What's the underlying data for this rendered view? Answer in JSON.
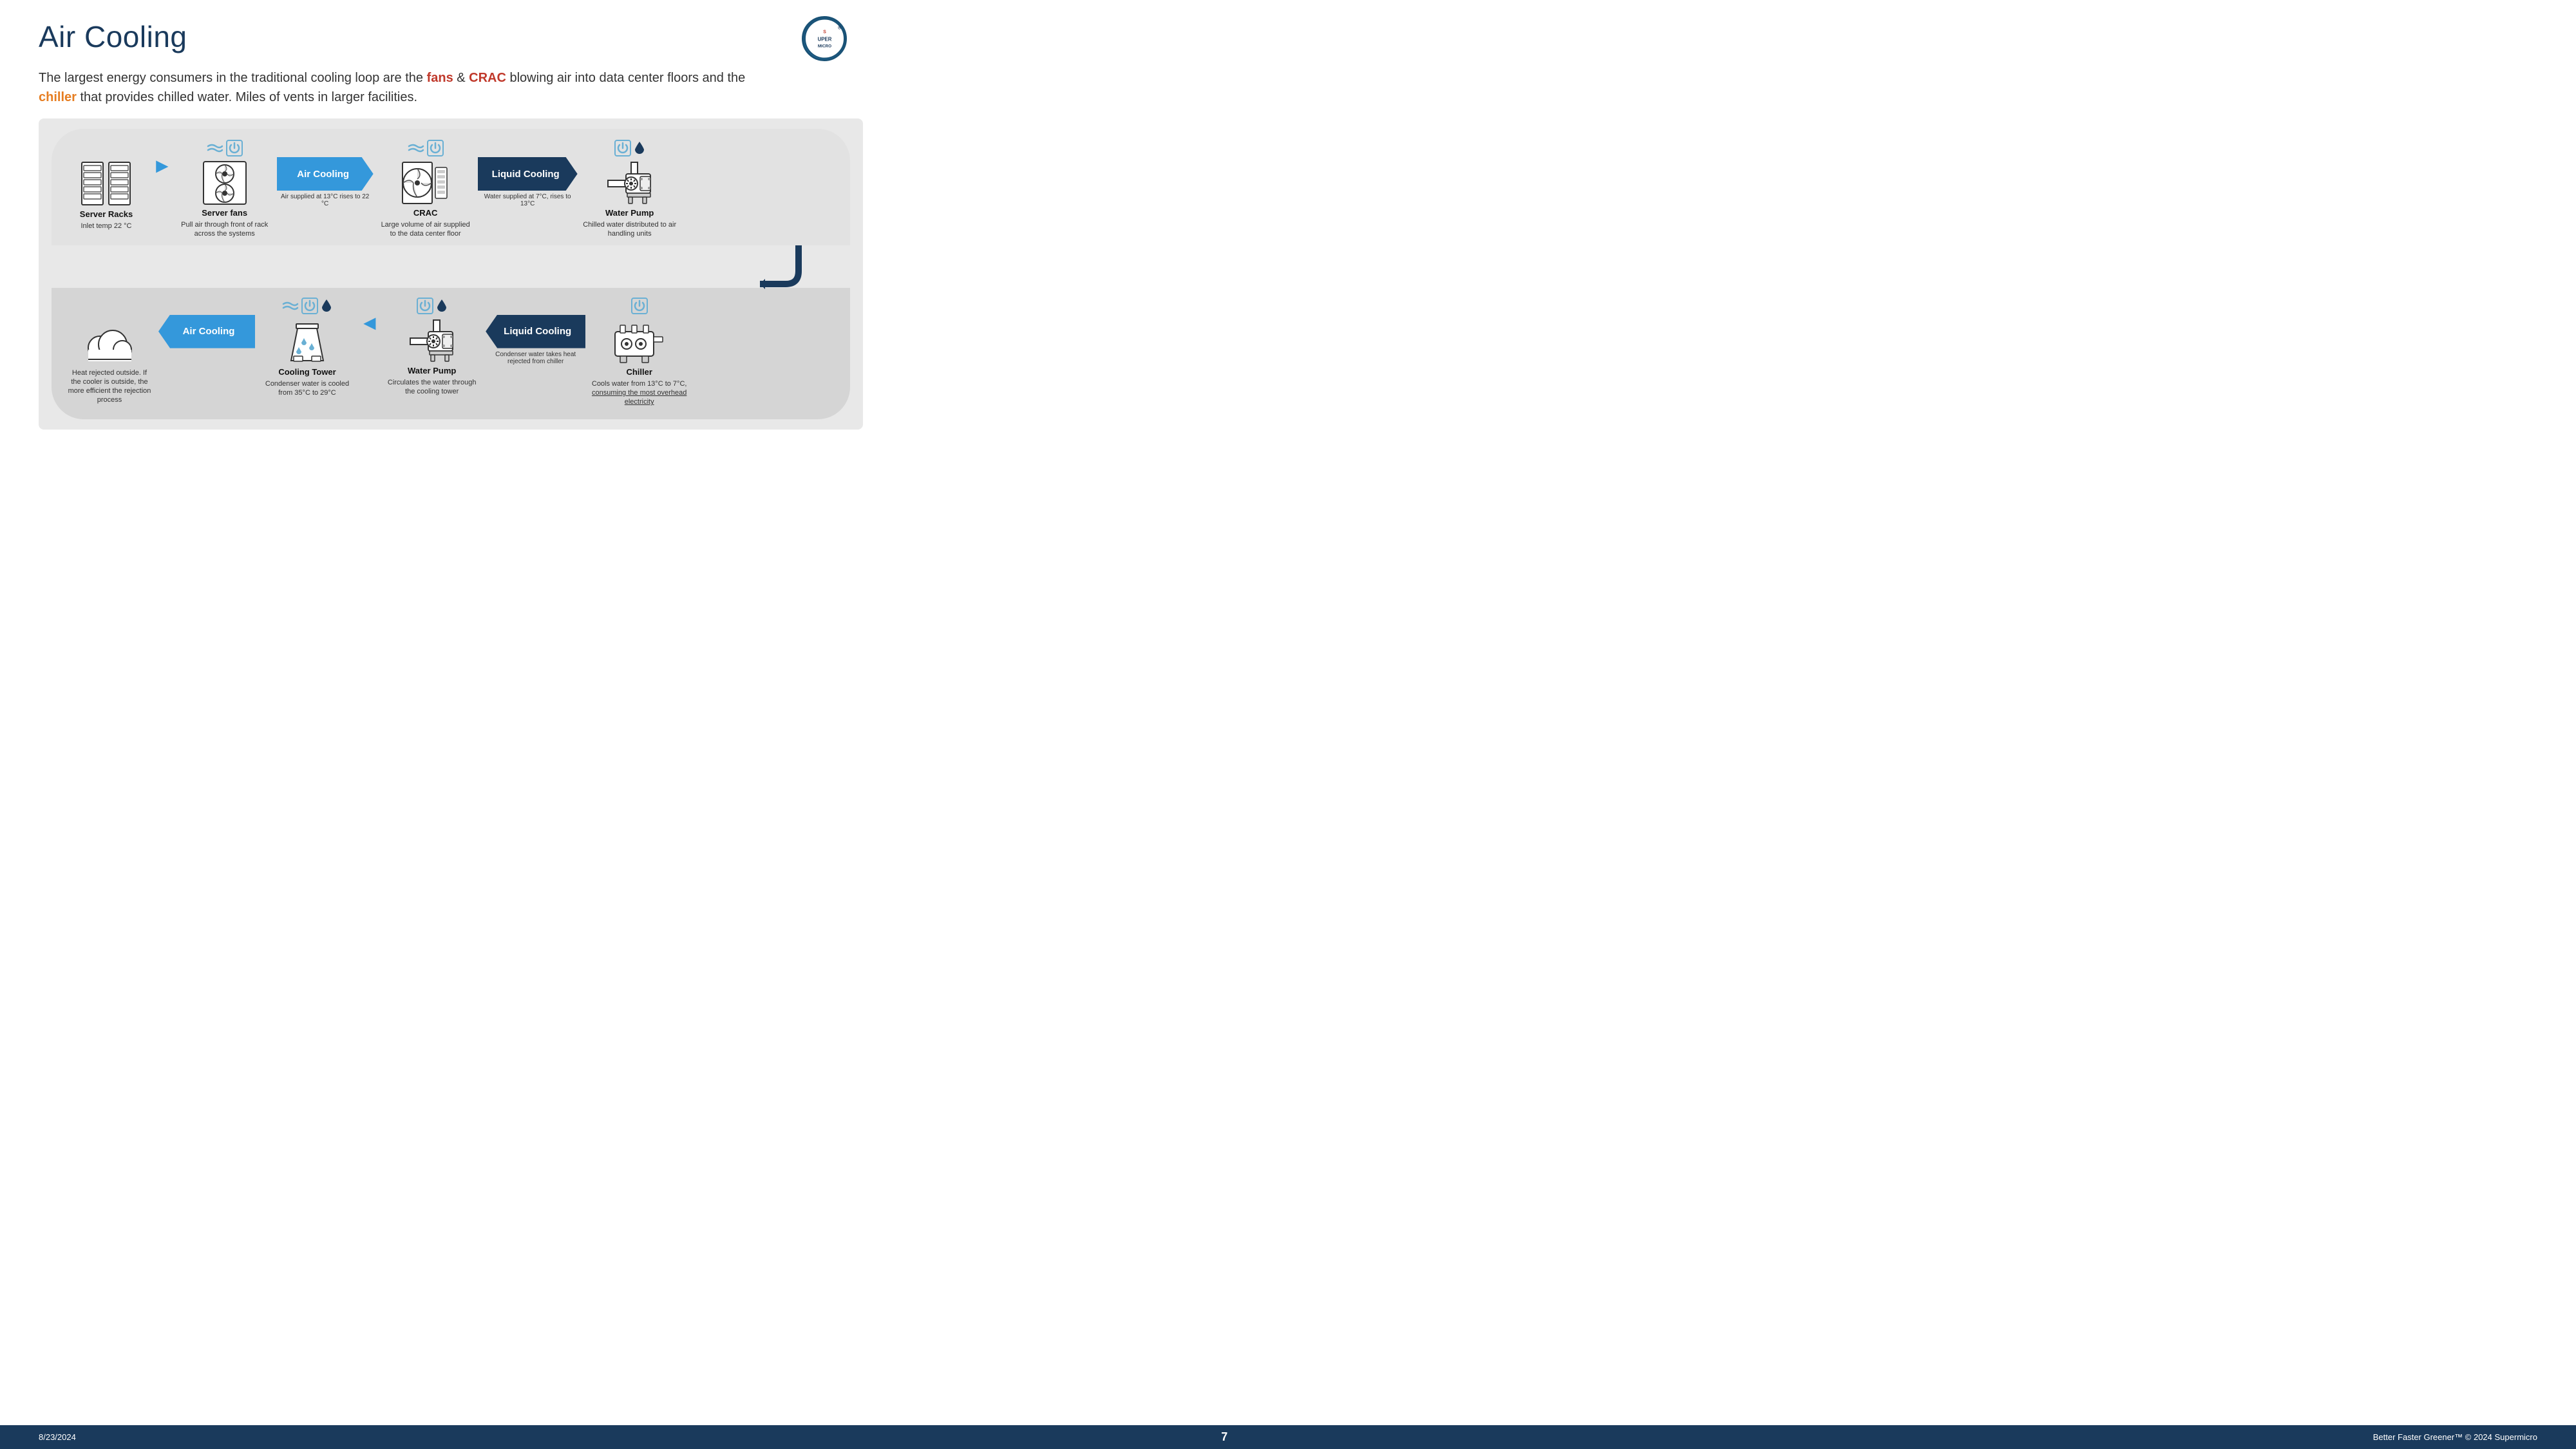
{
  "slide": {
    "title": "Air Cooling",
    "logo_text": "SUPERMICRO",
    "subtitle_before_fans": "The largest energy consumers in the traditional cooling loop are the ",
    "fans_label": "fans",
    "subtitle_between": " & ",
    "crac_label": "CRAC",
    "subtitle_after_crac": " blowing air into data center floors and the ",
    "chiller_label": "chiller",
    "subtitle_after_chiller": " that provides chilled water. Miles of vents in larger facilities.",
    "top_row": [
      {
        "id": "server-racks",
        "icon_type": "server-racks",
        "top_icons": [],
        "label": "Server Racks",
        "desc": "Inlet temp 22 °C"
      },
      {
        "id": "arrow-right-1",
        "type": "arrow-connector-right"
      },
      {
        "id": "server-fans",
        "icon_type": "server-fans",
        "top_icons": [
          "wind",
          "power"
        ],
        "label": "Server fans",
        "desc": "Pull air through front of rack across the systems"
      },
      {
        "id": "air-cooling-arrow-1",
        "type": "blue-arrow",
        "label": "Air Cooling"
      },
      {
        "id": "crac",
        "icon_type": "crac",
        "top_icons": [
          "wind",
          "power"
        ],
        "label": "CRAC",
        "desc": "Large volume of air supplied to the data center floor"
      },
      {
        "id": "liquid-cooling-arrow-1",
        "type": "dark-blue-arrow",
        "label": "Liquid Cooling"
      },
      {
        "id": "water-pump-top",
        "icon_type": "water-pump",
        "top_icons": [
          "power",
          "water"
        ],
        "label": "Water Pump",
        "desc": "Chilled water distributed to air handling units"
      }
    ],
    "air_cooling_top_label": "Air Cooling",
    "liquid_cooling_top_label": "Liquid Cooling",
    "air_supplied_label": "Air supplied at 13°C rises to 22 °C",
    "water_supplied_label": "Water supplied at 7°C, rises to 13°C",
    "bottom_row": [
      {
        "id": "clouds",
        "icon_type": "clouds",
        "top_icons": [],
        "label": "",
        "desc": "Heat rejected outside. If the cooler is outside, the more efficient the rejection process"
      },
      {
        "id": "air-cooling-arrow-2",
        "type": "blue-arrow-left",
        "label": "Air Cooling"
      },
      {
        "id": "cooling-tower",
        "icon_type": "cooling-tower",
        "top_icons": [
          "wind",
          "power",
          "water"
        ],
        "label": "Cooling Tower",
        "desc": "Condenser water is cooled from 35°C to 29°C"
      },
      {
        "id": "arrow-left-1",
        "type": "arrow-connector-left"
      },
      {
        "id": "water-pump-bottom",
        "icon_type": "water-pump",
        "top_icons": [
          "power",
          "water"
        ],
        "label": "Water Pump",
        "desc": "Circulates the water through the cooling tower"
      },
      {
        "id": "liquid-cooling-arrow-2",
        "type": "dark-blue-arrow-left",
        "label": "Liquid Cooling"
      },
      {
        "id": "chiller",
        "icon_type": "chiller",
        "top_icons": [
          "power"
        ],
        "label": "Chiller",
        "desc_normal": "Cools water from 13°C to 7°C, ",
        "desc_underline": "consuming the most overhead electricity"
      }
    ],
    "footer": {
      "date": "8/23/2024",
      "page": "7",
      "tagline": "Better Faster Greener™  © 2024 Supermicro"
    }
  }
}
